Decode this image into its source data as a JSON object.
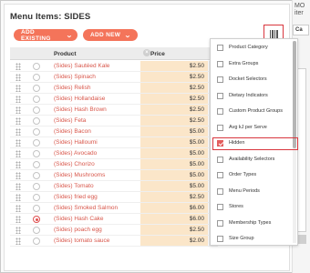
{
  "page": {
    "title": "Menu Items: SIDES"
  },
  "toolbar": {
    "add_existing_label": "ADD EXISTING",
    "add_new_label": "ADD NEW",
    "chevron_icon": "chevron-down-icon",
    "column_chooser_icon": "columns-icon"
  },
  "table": {
    "headers": {
      "product": "Product",
      "price": "Price"
    },
    "rows": [
      {
        "product": "(Sides) Sautéed Kale",
        "price": "$2.50",
        "selected": false,
        "deletable": false
      },
      {
        "product": "(Sides) Spinach",
        "price": "$2.50",
        "selected": false,
        "deletable": false
      },
      {
        "product": "(Sides) Relish",
        "price": "$2.50",
        "selected": false,
        "deletable": false
      },
      {
        "product": "(Sides) Hollandaise",
        "price": "$2.50",
        "selected": false,
        "deletable": false
      },
      {
        "product": "(Sides) Hash Brown",
        "price": "$2.50",
        "selected": false,
        "deletable": false
      },
      {
        "product": "(Sides) Feta",
        "price": "$2.50",
        "selected": false,
        "deletable": false
      },
      {
        "product": "(Sides) Bacon",
        "price": "$5.00",
        "selected": false,
        "deletable": false
      },
      {
        "product": "(Sides) Halloumi",
        "price": "$5.00",
        "selected": false,
        "deletable": false
      },
      {
        "product": "(Sides) Avocado",
        "price": "$5.00",
        "selected": false,
        "deletable": false
      },
      {
        "product": "(Sides) Chorizo",
        "price": "$5.00",
        "selected": false,
        "deletable": false
      },
      {
        "product": "(Sides) Mushrooms",
        "price": "$5.00",
        "selected": false,
        "deletable": false
      },
      {
        "product": "(Sides) Tomato",
        "price": "$5.00",
        "selected": false,
        "deletable": false
      },
      {
        "product": "(Sides) fried egg",
        "price": "$2.50",
        "selected": false,
        "deletable": false
      },
      {
        "product": "(Sides) Smoked Salmon",
        "price": "$6.00",
        "selected": false,
        "deletable": false
      },
      {
        "product": "(Sides) Hash Cake",
        "price": "$6.00",
        "selected": true,
        "deletable": true
      },
      {
        "product": "(Sides) poach egg",
        "price": "$2.50",
        "selected": false,
        "deletable": true
      },
      {
        "product": "(Sides) tomato sauce",
        "price": "$2.00",
        "selected": false,
        "deletable": true
      }
    ]
  },
  "column_menu": {
    "items": [
      {
        "label": "Product Category",
        "checked": false
      },
      {
        "label": "Extra Groups",
        "checked": false
      },
      {
        "label": "Docket Selectors",
        "checked": false
      },
      {
        "label": "Dietary Indicators",
        "checked": false
      },
      {
        "label": "Custom Product Groups",
        "checked": false
      },
      {
        "label": "Avg kJ per Serve",
        "checked": false
      },
      {
        "label": "Hidden",
        "checked": true,
        "highlighted": true
      },
      {
        "label": "Availability Selectors",
        "checked": false
      },
      {
        "label": "Order Types",
        "checked": false
      },
      {
        "label": "Menu Periods",
        "checked": false
      },
      {
        "label": "Stores",
        "checked": false
      },
      {
        "label": "Membership Types",
        "checked": false
      },
      {
        "label": "Size Group",
        "checked": false
      }
    ]
  },
  "right_panel": {
    "line1": "MO",
    "line2": "iter",
    "cell": "Ca"
  },
  "colors": {
    "accent": "#f4745a",
    "highlight": "#d9363e",
    "price_bg": "#fbe6c9",
    "link": "#d8564a"
  }
}
